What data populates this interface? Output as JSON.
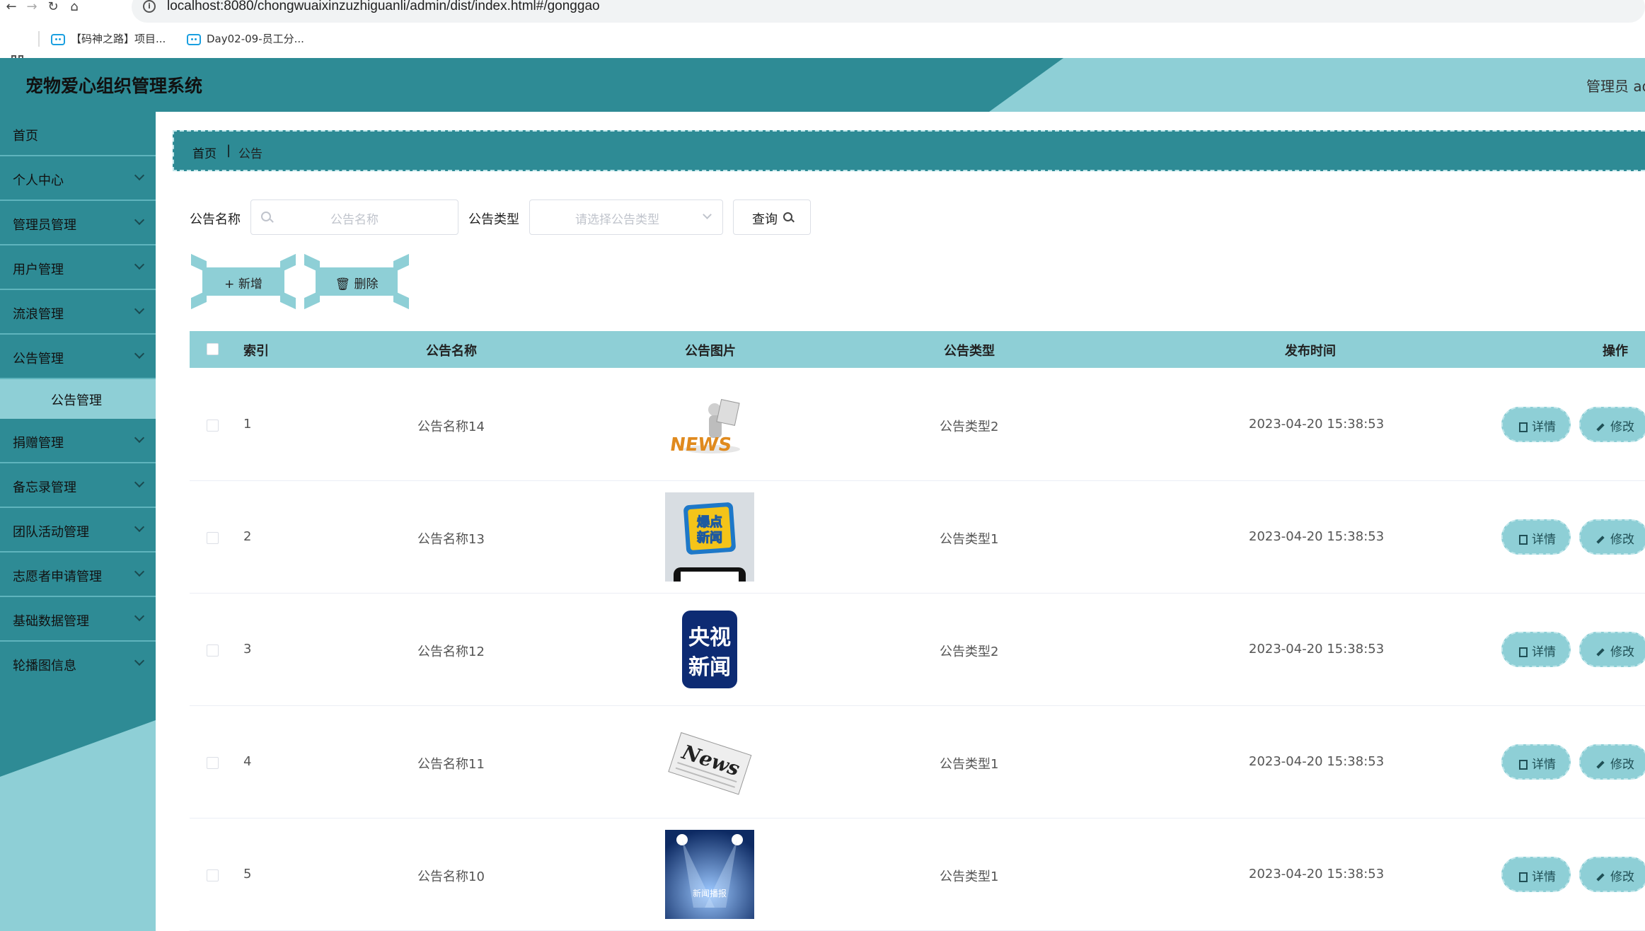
{
  "browser": {
    "url": "localhost:8080/chongwuaixinzuzhiguanli/admin/dist/index.html#/gonggao",
    "bookmarks": [
      "【码神之路】项目...",
      "Day02-09-员工分..."
    ]
  },
  "header": {
    "title": "宠物爱心组织管理系统",
    "admin_text": "管理员 ad"
  },
  "sidebar": {
    "items": [
      {
        "label": "首页",
        "has_children": false
      },
      {
        "label": "个人中心",
        "has_children": true
      },
      {
        "label": "管理员管理",
        "has_children": true
      },
      {
        "label": "用户管理",
        "has_children": true
      },
      {
        "label": "流浪管理",
        "has_children": true
      },
      {
        "label": "公告管理",
        "has_children": true
      },
      {
        "label": "捐赠管理",
        "has_children": true
      },
      {
        "label": "备忘录管理",
        "has_children": true
      },
      {
        "label": "团队活动管理",
        "has_children": true
      },
      {
        "label": "志愿者申请管理",
        "has_children": true
      },
      {
        "label": "基础数据管理",
        "has_children": true
      },
      {
        "label": "轮播图信息",
        "has_children": true
      }
    ],
    "active_sub": "公告管理"
  },
  "breadcrumb": {
    "home": "首页",
    "separator": "|",
    "current": "公告"
  },
  "search": {
    "name_label": "公告名称",
    "name_placeholder": "公告名称",
    "type_label": "公告类型",
    "type_placeholder": "请选择公告类型",
    "query_label": "查询"
  },
  "actions": {
    "add_label": "新增",
    "delete_label": "删除"
  },
  "table": {
    "columns": [
      "索引",
      "公告名称",
      "公告图片",
      "公告类型",
      "发布时间",
      "操作"
    ],
    "detail_label": "详情",
    "edit_label": "修改",
    "rows": [
      {
        "index": "1",
        "name": "公告名称14",
        "image": "news-3d-figure",
        "type": "公告类型2",
        "time": "2023-04-20 15:38:53"
      },
      {
        "index": "2",
        "name": "公告名称13",
        "image": "baodian-xinwen",
        "type": "公告类型1",
        "time": "2023-04-20 15:38:53"
      },
      {
        "index": "3",
        "name": "公告名称12",
        "image": "yangshi-xinwen",
        "type": "公告类型2",
        "time": "2023-04-20 15:38:53"
      },
      {
        "index": "4",
        "name": "公告名称11",
        "image": "news-paper",
        "type": "公告类型1",
        "time": "2023-04-20 15:38:53"
      },
      {
        "index": "5",
        "name": "公告名称10",
        "image": "news-stage",
        "type": "公告类型1",
        "time": "2023-04-20 15:38:53"
      }
    ],
    "image_texts": {
      "thumb2": "爆点\n新闻",
      "thumb3_line1": "央视",
      "thumb3_line2": "新闻",
      "thumb4": "News",
      "thumb5": "新闻播报",
      "thumb1": "NEWS"
    }
  },
  "colors": {
    "primary": "#2e8b95",
    "light": "#8ecfd6"
  }
}
